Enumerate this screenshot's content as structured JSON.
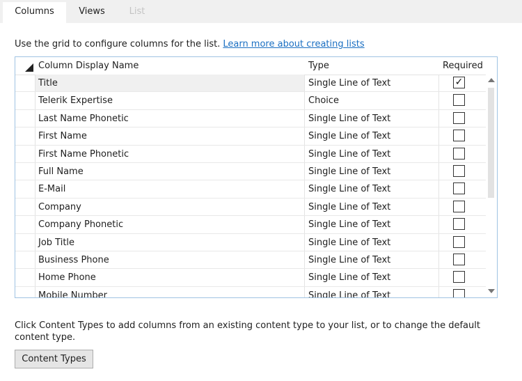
{
  "tabs": [
    {
      "label": "Columns"
    },
    {
      "label": "Views"
    },
    {
      "label": "List"
    }
  ],
  "intro": {
    "text": "Use the grid to configure columns for the list.",
    "link": "Learn more about creating lists"
  },
  "grid": {
    "headers": {
      "name": "Column Display Name",
      "type": "Type",
      "required": "Required"
    },
    "rows": [
      {
        "name": "Title",
        "type": "Single Line of Text",
        "required": true
      },
      {
        "name": "Telerik Expertise",
        "type": "Choice",
        "required": false
      },
      {
        "name": "Last Name Phonetic",
        "type": "Single Line of Text",
        "required": false
      },
      {
        "name": "First Name",
        "type": "Single Line of Text",
        "required": false
      },
      {
        "name": "First Name Phonetic",
        "type": "Single Line of Text",
        "required": false
      },
      {
        "name": "Full Name",
        "type": "Single Line of Text",
        "required": false
      },
      {
        "name": "E-Mail",
        "type": "Single Line of Text",
        "required": false
      },
      {
        "name": "Company",
        "type": "Single Line of Text",
        "required": false
      },
      {
        "name": "Company Phonetic",
        "type": "Single Line of Text",
        "required": false
      },
      {
        "name": "Job Title",
        "type": "Single Line of Text",
        "required": false
      },
      {
        "name": "Business Phone",
        "type": "Single Line of Text",
        "required": false
      },
      {
        "name": "Home Phone",
        "type": "Single Line of Text",
        "required": false
      },
      {
        "name": "Mobile Number",
        "type": "Single Line of Text",
        "required": false
      }
    ]
  },
  "footer": {
    "text": "Click Content Types to add columns from an existing content type to your list, or to change the default content type.",
    "button": "Content Types"
  },
  "colors": {
    "accent": "#1a6fc2",
    "grid_border": "#9fc3e3"
  }
}
